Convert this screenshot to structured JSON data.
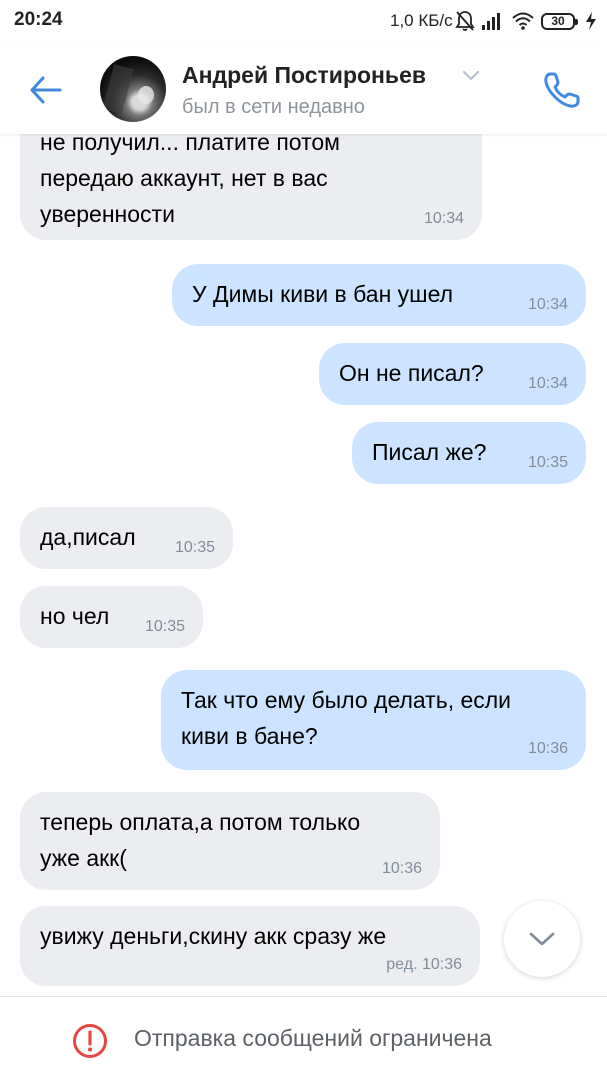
{
  "status_bar": {
    "time": "20:24",
    "network_speed": "1,0 КБ/с",
    "battery_level": "30",
    "icons": [
      "mute-bell-icon",
      "signal-icon",
      "wifi-icon",
      "battery-icon",
      "charging-icon"
    ]
  },
  "header": {
    "contact_name": "Андрей Постироньев",
    "contact_status": "был в сети недавно",
    "icons": [
      "back-arrow-icon",
      "avatar",
      "chevron-down-icon",
      "phone-icon"
    ],
    "accent_color": "#3f8ae0"
  },
  "messages": [
    {
      "side": "in",
      "text": "не получил... платите потом\nпередаю аккаунт, нет в вас\nуверенности",
      "time": "10:34"
    },
    {
      "side": "out",
      "text": "У Димы киви в бан ушел",
      "time": "10:34"
    },
    {
      "side": "out",
      "text": "Он не писал?",
      "time": "10:34"
    },
    {
      "side": "out",
      "text": "Писал же?",
      "time": "10:35"
    },
    {
      "side": "in",
      "text": "да,писал",
      "time": "10:35"
    },
    {
      "side": "in",
      "text": "но чел",
      "time": "10:35"
    },
    {
      "side": "out",
      "text": "Так что ему было делать, если\nкиви в бане?",
      "time": "10:36"
    },
    {
      "side": "in",
      "text": "теперь оплата,а потом только\nуже акк(",
      "time": "10:36"
    },
    {
      "side": "in",
      "text": "увижу деньги,скину акк сразу же",
      "time": "ред. 10:36"
    }
  ],
  "colors": {
    "incoming_bubble": "#ebedf0",
    "outgoing_bubble": "#cce4ff",
    "warning": "#e64646"
  },
  "bottom_bar": {
    "text": "Отправка сообщений ограничена",
    "icon": "warning-circle-icon"
  }
}
